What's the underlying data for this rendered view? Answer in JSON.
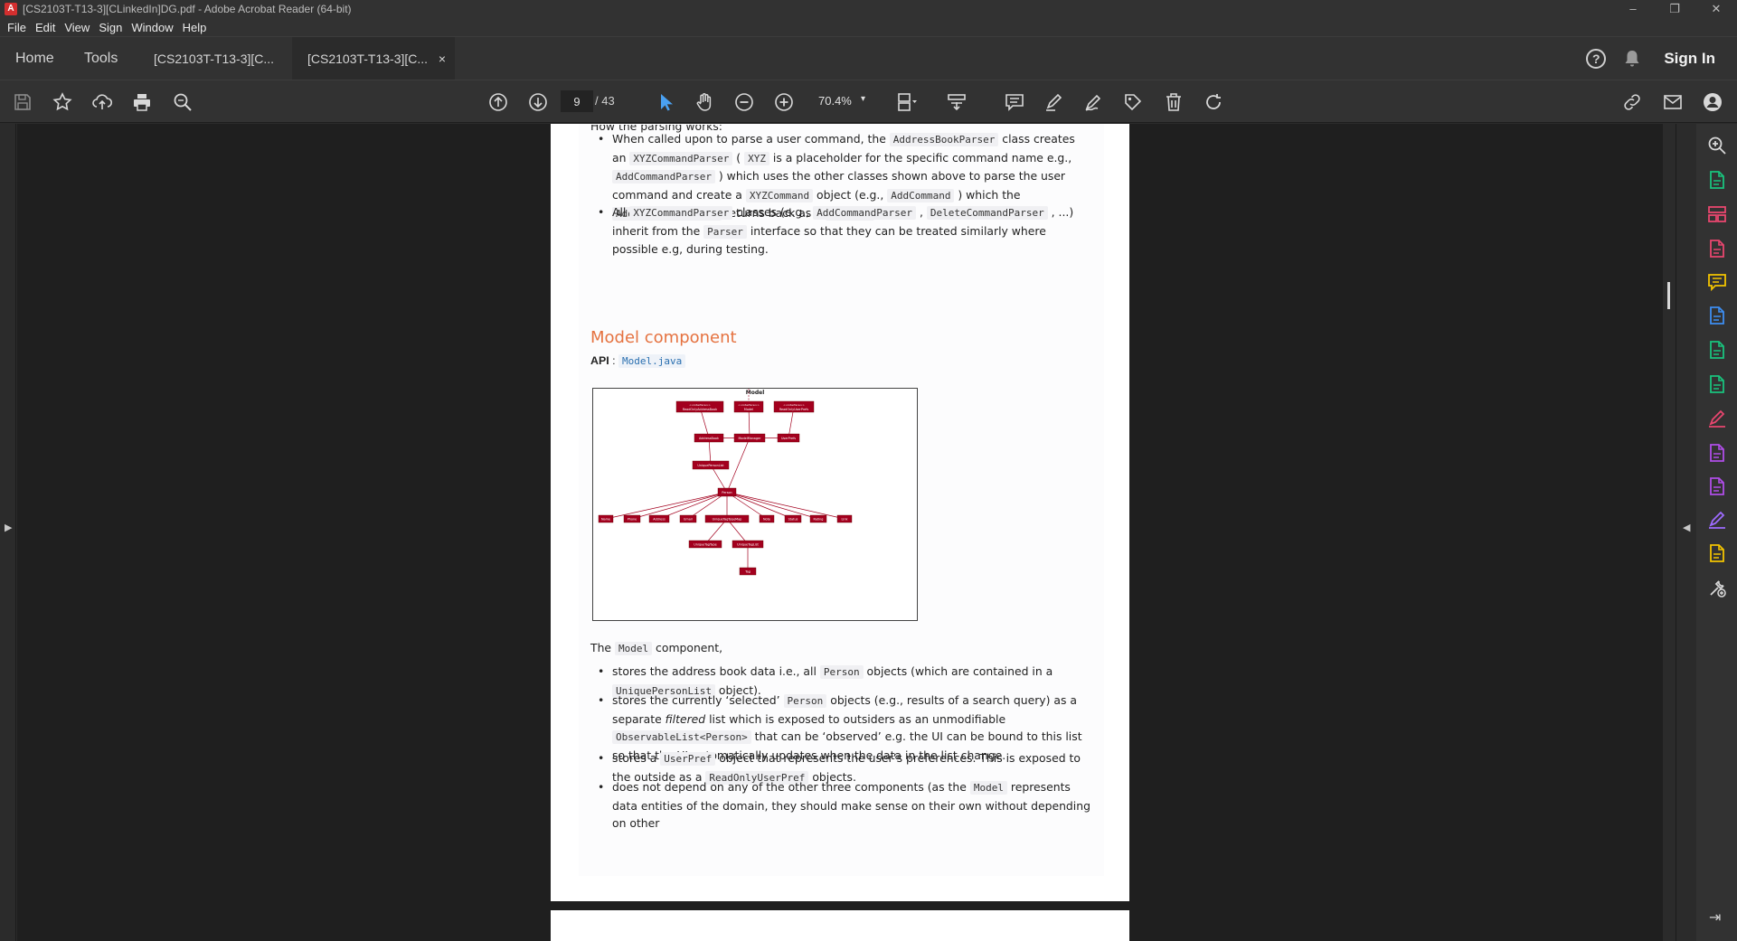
{
  "window": {
    "title": "[CS2103T-T13-3][CLinkedIn]DG.pdf - Adobe Acrobat Reader (64-bit)",
    "app_icon": "acrobat-icon",
    "controls": [
      "–",
      "❐",
      "✕"
    ]
  },
  "menu": [
    "File",
    "Edit",
    "View",
    "Sign",
    "Window",
    "Help"
  ],
  "tabs": {
    "home": "Home",
    "tools": "Tools",
    "doc1": "[CS2103T-T13-3][C...",
    "doc2": "[CS2103T-T13-3][C...",
    "close": "×"
  },
  "header": {
    "help": "?",
    "signin": "Sign In"
  },
  "toolbar": {
    "page_current": "9",
    "page_total": "/ 43",
    "zoom": "70.4%",
    "zoom_caret": "▾",
    "icons": [
      "save-icon",
      "bookmark-star-icon",
      "upload-cloud-icon",
      "print-icon",
      "find-icon",
      "page-up-icon",
      "page-down-icon",
      "select-cursor-icon",
      "hand-icon",
      "zoom-out-icon",
      "zoom-in-icon",
      "page-view-icon",
      "scroll-mode-icon",
      "comment-icon",
      "highlight-pen-icon",
      "sign-icon",
      "stamp-icon",
      "delete-icon",
      "rotate-icon",
      "link-icon",
      "email-icon",
      "account-icon"
    ]
  },
  "document": {
    "parse_heading": "How the parsing works:",
    "bullets1": [
      {
        "parts": [
          [
            "t",
            "When called upon to parse a user command, the "
          ],
          [
            "c",
            "AddressBookParser"
          ],
          [
            "t",
            " class creates an "
          ],
          [
            "c",
            "XYZCommandParser"
          ],
          [
            "t",
            " ( "
          ],
          [
            "c",
            "XYZ"
          ],
          [
            "t",
            " is a placeholder for the specific command name e.g., "
          ],
          [
            "c",
            "AddCommandParser"
          ],
          [
            "t",
            " ) which uses the other classes shown above to parse the user command and create a "
          ],
          [
            "c",
            "XYZCommand"
          ],
          [
            "t",
            " object (e.g., "
          ],
          [
            "c",
            "AddCommand"
          ],
          [
            "t",
            " ) which the "
          ],
          [
            "c",
            "AddressBookParser"
          ],
          [
            "t",
            " returns back as a "
          ],
          [
            "c",
            "Command"
          ],
          [
            "t",
            " object."
          ]
        ]
      },
      {
        "parts": [
          [
            "t",
            "All "
          ],
          [
            "c",
            "XYZCommandParser"
          ],
          [
            "t",
            " classes (e.g., "
          ],
          [
            "c",
            "AddCommandParser"
          ],
          [
            "t",
            " , "
          ],
          [
            "c",
            "DeleteCommandParser"
          ],
          [
            "t",
            " , ...) inherit from the "
          ],
          [
            "c",
            "Parser"
          ],
          [
            "t",
            " interface so that they can be treated similarly where possible e.g, during testing."
          ]
        ]
      }
    ],
    "model_heading": "Model component",
    "api_label": "API",
    "api_sep": " : ",
    "api_link": "Model.java",
    "diagram_title": "Model",
    "diagram_nodes": {
      "readonly_ab": "ReadOnlyAddressBook",
      "model": "Model",
      "readonly_up": "ReadOnlyUserPrefs",
      "addressbook": "AddressBook",
      "modelmanager": "ModelManager",
      "userprefs": "UserPrefs",
      "uniquepersonlist": "UniquePersonList",
      "person": "Person",
      "name": "Name",
      "phone": "Phone",
      "address": "Address",
      "email": "Email",
      "uniquetagtypemap": "UniqueTagTypeMap",
      "note": "Note",
      "status": "Status",
      "rating": "Rating",
      "link": "Link",
      "uniquetagtype": "UniqueTagType",
      "uniquetaglist": "UniqueTagList",
      "tag": "Tag",
      "interface_label": "<<interface>>"
    },
    "model_intro": [
      [
        "t",
        "The "
      ],
      [
        "c",
        "Model"
      ],
      [
        "t",
        " component,"
      ]
    ],
    "bullets2": [
      {
        "parts": [
          [
            "t",
            "stores the address book data i.e., all "
          ],
          [
            "c",
            "Person"
          ],
          [
            "t",
            " objects (which are contained in a "
          ],
          [
            "c",
            "UniquePersonList"
          ],
          [
            "t",
            " object)."
          ]
        ]
      },
      {
        "parts": [
          [
            "t",
            "stores the currently ‘selected’ "
          ],
          [
            "c",
            "Person"
          ],
          [
            "t",
            " objects (e.g., results of a search query) as a separate "
          ],
          [
            "i",
            "filtered"
          ],
          [
            "t",
            " list which is exposed to outsiders as an unmodifiable "
          ],
          [
            "c",
            "ObservableList<Person>"
          ],
          [
            "t",
            " that can be ‘observed’ e.g. the UI can be bound to this list so that the UI automatically updates when the data in the list change."
          ]
        ]
      },
      {
        "parts": [
          [
            "t",
            "stores a "
          ],
          [
            "c",
            "UserPref"
          ],
          [
            "t",
            " object that represents the user’s preferences. This is exposed to the outside as a "
          ],
          [
            "c",
            "ReadOnlyUserPref"
          ],
          [
            "t",
            " objects."
          ]
        ]
      },
      {
        "parts": [
          [
            "t",
            "does not depend on any of the other three components (as the "
          ],
          [
            "c",
            "Model"
          ],
          [
            "t",
            " represents data entities of the domain, they should make sense on their own without depending on other"
          ]
        ]
      }
    ]
  },
  "right_tools": [
    "search-zoom-icon",
    "export-pdf-icon",
    "organize-pages-icon",
    "create-pdf-icon",
    "comment-tool-icon",
    "combine-files-icon",
    "compress-icon",
    "edit-pdf-icon",
    "fill-sign-icon",
    "request-signature-icon",
    "protect-icon",
    "sign-pen-icon",
    "send-review-icon",
    "more-tools-icon"
  ],
  "colors": {
    "accent_blue": "#4aa1f2",
    "heading_orange": "#e57240",
    "diagram_red": "#a3001e"
  }
}
